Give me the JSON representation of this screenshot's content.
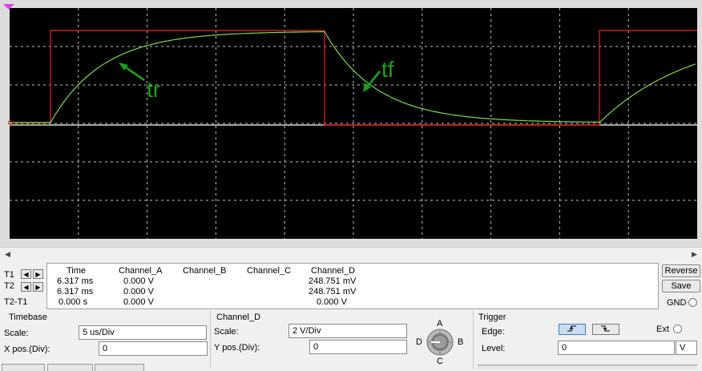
{
  "annotations": {
    "rise": "tr",
    "fall": "tf"
  },
  "cursors": {
    "t1": "T1",
    "t2": "T2"
  },
  "readout": {
    "headers": [
      "Time",
      "Channel_A",
      "Channel_B",
      "Channel_C",
      "Channel_D"
    ],
    "rows": [
      {
        "label": "T1",
        "time": "6.317 ms",
        "a": "0.000 V",
        "b": "",
        "c": "",
        "d": "248.751 mV"
      },
      {
        "label": "T2",
        "time": "6.317 ms",
        "a": "0.000 V",
        "b": "",
        "c": "",
        "d": "248.751 mV"
      },
      {
        "label": "T2-T1",
        "time": "0.000 s",
        "a": "0.000 V",
        "b": "",
        "c": "",
        "d": "0.000 V"
      }
    ]
  },
  "buttons": {
    "reverse": "Reverse",
    "save": "Save",
    "gnd": "GND"
  },
  "timebase": {
    "title": "Timebase",
    "scale_label": "Scale:",
    "scale": "5 us/Div",
    "xpos_label": "X pos.(Div):",
    "xpos": "0"
  },
  "channel": {
    "title": "Channel_D",
    "scale_label": "Scale:",
    "scale": "2  V/Div",
    "ypos_label": "Y pos.(Div):",
    "ypos": "0"
  },
  "selector": {
    "a": "A",
    "b": "B",
    "c": "C",
    "d": "D"
  },
  "trigger": {
    "title": "Trigger",
    "edge_label": "Edge:",
    "ext_label": "Ext",
    "level_label": "Level:",
    "level": "0",
    "unit": "V"
  },
  "colors": {
    "screen_bg": "#000000",
    "grid": "#ffffff",
    "square": "#d01818",
    "response": "#7cd848",
    "annotation": "#19a019"
  }
}
